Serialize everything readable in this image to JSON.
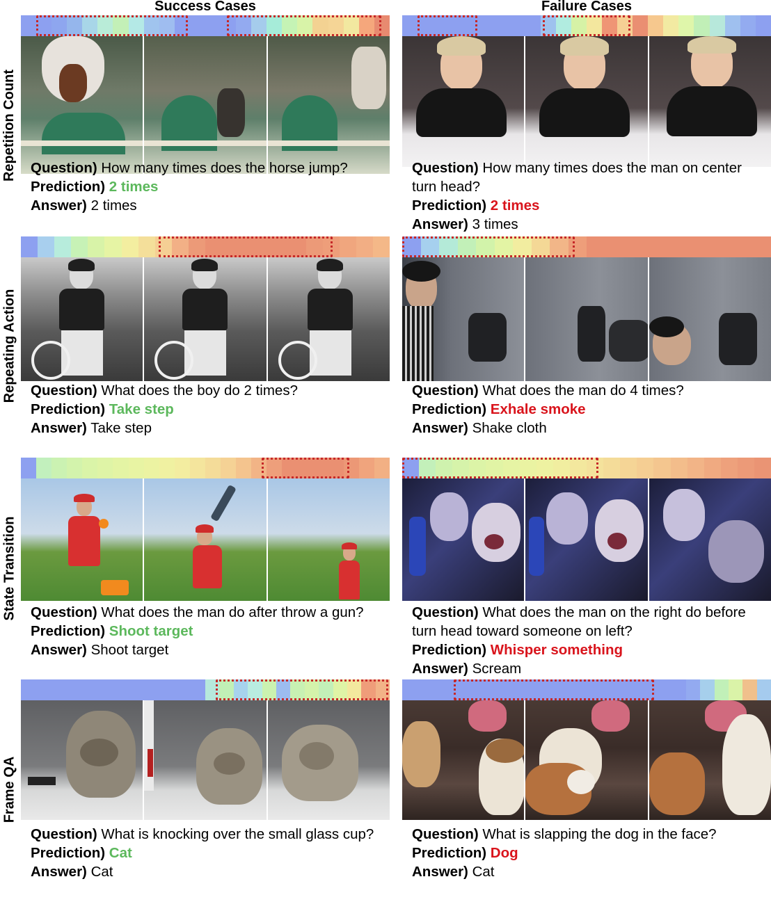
{
  "columns": {
    "success": "Success Cases",
    "failure": "Failure Cases"
  },
  "rows": [
    "Repetition Count",
    "Repeating Action",
    "State Transition",
    "Frame QA"
  ],
  "labels": {
    "question": "Question)",
    "prediction": "Prediction)",
    "answer": "Answer)"
  },
  "cases": {
    "rc_s": {
      "question": "How many times does the horse jump?",
      "prediction": "2 times",
      "answer": "2 times"
    },
    "rc_f": {
      "question": "How many times does the man on center turn head?",
      "prediction": "2 times",
      "answer": "3 times"
    },
    "ra_s": {
      "question": "What does the boy do 2 times?",
      "prediction": "Take step",
      "answer": "Take step"
    },
    "ra_f": {
      "question": "What does the man do 4 times?",
      "prediction": "Exhale smoke",
      "answer": "Shake cloth"
    },
    "st_s": {
      "question": "What does the man do after throw a gun?",
      "prediction": "Shoot target",
      "answer": "Shoot target"
    },
    "st_f": {
      "question": "What does the man on the right do before turn head toward someone on left?",
      "prediction": "Whisper something",
      "answer": "Scream"
    },
    "fq_s": {
      "question": "What is knocking over the small glass cup?",
      "prediction": "Cat",
      "answer": "Cat"
    },
    "fq_f": {
      "question": "What is slapping the dog in the face?",
      "prediction": "Dog",
      "answer": "Cat"
    }
  },
  "colors": {
    "correct": "#5cb85c",
    "wrong": "#d9141c",
    "highlight": "#c62828"
  }
}
